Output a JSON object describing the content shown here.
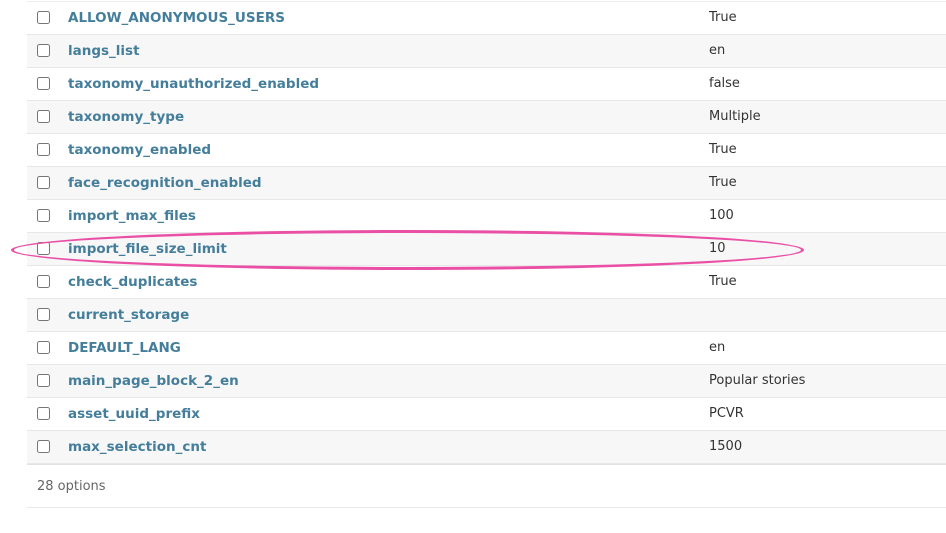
{
  "options_table": {
    "rows": [
      {
        "key": "ALLOW_ANONYMOUS_USERS",
        "value": "True"
      },
      {
        "key": "langs_list",
        "value": "en"
      },
      {
        "key": "taxonomy_unauthorized_enabled",
        "value": "false"
      },
      {
        "key": "taxonomy_type",
        "value": "Multiple"
      },
      {
        "key": "taxonomy_enabled",
        "value": "True"
      },
      {
        "key": "face_recognition_enabled",
        "value": "True"
      },
      {
        "key": "import_max_files",
        "value": "100"
      },
      {
        "key": "import_file_size_limit",
        "value": "10"
      },
      {
        "key": "check_duplicates",
        "value": "True"
      },
      {
        "key": "current_storage",
        "value": ""
      },
      {
        "key": "DEFAULT_LANG",
        "value": "en"
      },
      {
        "key": "main_page_block_2_en",
        "value": "Popular stories"
      },
      {
        "key": "asset_uuid_prefix",
        "value": "PCVR"
      },
      {
        "key": "max_selection_cnt",
        "value": "1500"
      }
    ]
  },
  "result_count": "28 options",
  "highlight": {
    "target_row": "import_file_size_limit",
    "color": "#ea4fa6"
  },
  "colors": {
    "link": "#447e9b",
    "row_alt": "#f7f7f7",
    "text": "#333333"
  }
}
